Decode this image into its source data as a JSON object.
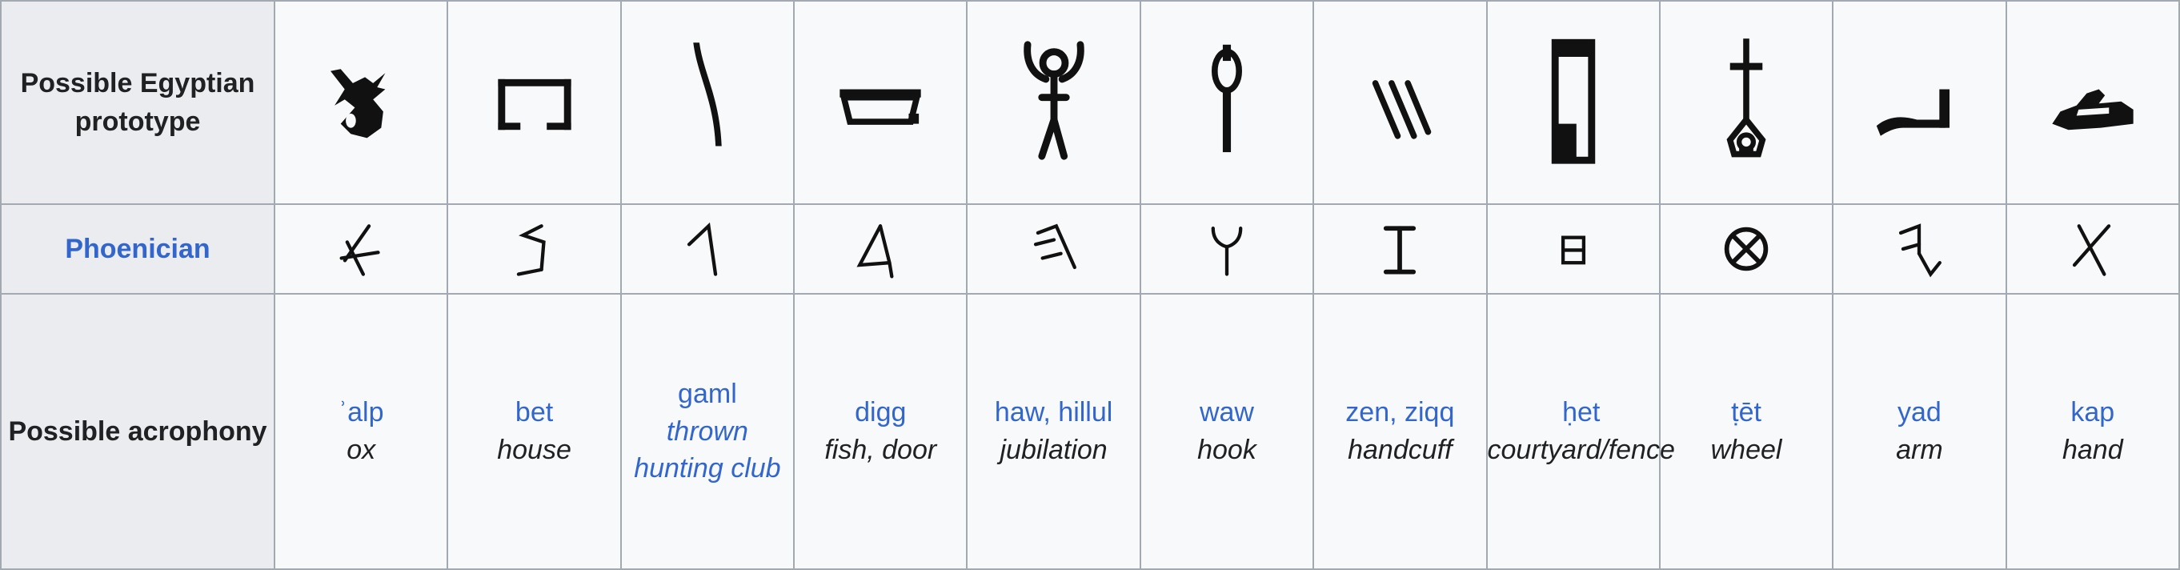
{
  "table": {
    "rows": {
      "egyptian_label": "Possible Egyptian prototype",
      "phoenician_label": "Phoenician",
      "acrophony_label": "Possible acrophony"
    },
    "colors": {
      "link": "#3366cc",
      "text": "#202122",
      "header_bg": "#eaecf0",
      "cell_bg": "#f8f9fa",
      "border": "#a2a9b1"
    },
    "columns": [
      {
        "egyptian_icon": "ox-head-hieroglyph",
        "phoenician_icon": "phoenician-aleph",
        "name": "ʾalp",
        "name_is_link": true,
        "gloss": "ox",
        "gloss_is_link": false
      },
      {
        "egyptian_icon": "house-plan-hieroglyph",
        "phoenician_icon": "phoenician-bet",
        "name": "bet",
        "name_is_link": true,
        "gloss": "house",
        "gloss_is_link": false
      },
      {
        "egyptian_icon": "throwstick-hieroglyph",
        "phoenician_icon": "phoenician-gimel",
        "name": "gaml",
        "name_is_link": true,
        "gloss": "thrown hunting club",
        "gloss_is_link": true
      },
      {
        "egyptian_icon": "fish-door-hieroglyph",
        "phoenician_icon": "phoenician-dalet",
        "name": "digg",
        "name_is_link": true,
        "gloss": "fish, door",
        "gloss_is_link": false
      },
      {
        "egyptian_icon": "jubilation-man-hieroglyph",
        "phoenician_icon": "phoenician-he",
        "name": "haw, hillul",
        "name_is_link": true,
        "gloss": "jubilation",
        "gloss_is_link": false
      },
      {
        "egyptian_icon": "hook-mace-hieroglyph",
        "phoenician_icon": "phoenician-waw",
        "name": "waw",
        "name_is_link": true,
        "gloss": "hook",
        "gloss_is_link": false
      },
      {
        "egyptian_icon": "three-strokes-hieroglyph",
        "phoenician_icon": "phoenician-zayin",
        "name": "zen, ziqq",
        "name_is_link": true,
        "gloss": "handcuff",
        "gloss_is_link": false
      },
      {
        "egyptian_icon": "courtyard-fence-hieroglyph",
        "phoenician_icon": "phoenician-het",
        "name": "ḥet",
        "name_is_link": true,
        "gloss": "courtyard/fence",
        "gloss_is_link": false
      },
      {
        "egyptian_icon": "wheel-spindle-hieroglyph",
        "phoenician_icon": "phoenician-tet",
        "name": "ṭēt",
        "name_is_link": true,
        "gloss": "wheel",
        "gloss_is_link": false
      },
      {
        "egyptian_icon": "arm-hieroglyph",
        "phoenician_icon": "phoenician-yod",
        "name": "yad",
        "name_is_link": true,
        "gloss": "arm",
        "gloss_is_link": false
      },
      {
        "egyptian_icon": "hand-hieroglyph",
        "phoenician_icon": "phoenician-kaph",
        "name": "kap",
        "name_is_link": true,
        "gloss": "hand",
        "gloss_is_link": false
      }
    ]
  }
}
